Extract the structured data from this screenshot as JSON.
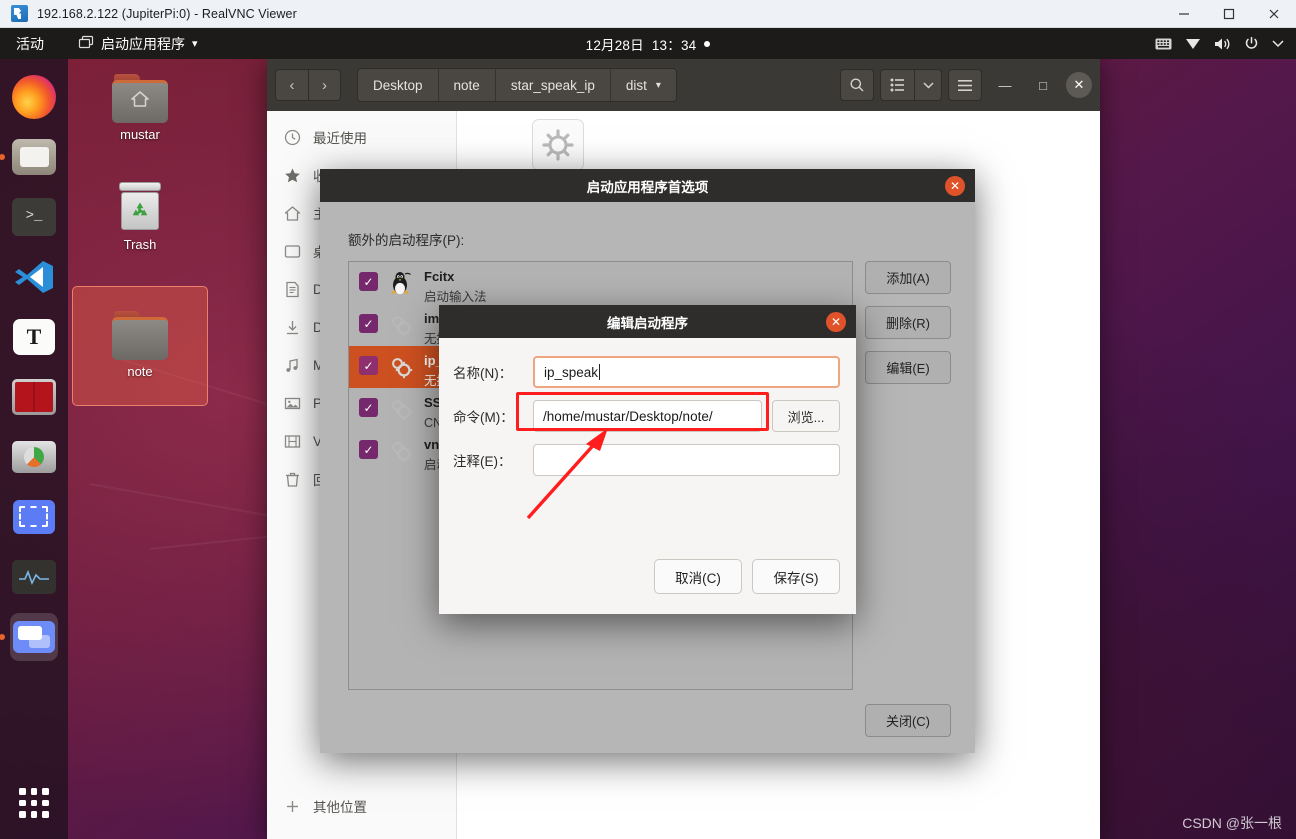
{
  "vnc_window": {
    "title": "192.168.2.122 (JupiterPi:0) - RealVNC Viewer",
    "icon": "realvnc-icon",
    "minimize_label": "—",
    "maximize_label": "☐",
    "close_label": "✕"
  },
  "gnome_panel": {
    "activities": "活动",
    "app_menu": "启动应用程序",
    "app_menu_arrow": "▾",
    "clock_date": "12月28日",
    "clock_time": "13：34",
    "tray": [
      "keyboard-icon",
      "network-icon",
      "volume-icon",
      "power-icon",
      "chevron-down-icon"
    ]
  },
  "dock": {
    "items": [
      {
        "name": "firefox",
        "running": false
      },
      {
        "name": "files",
        "running": true
      },
      {
        "name": "terminal",
        "running": false
      },
      {
        "name": "vscode",
        "running": false
      },
      {
        "name": "text-editor",
        "running": false
      },
      {
        "name": "red-app",
        "running": false
      },
      {
        "name": "disks",
        "running": false
      },
      {
        "name": "screenshot",
        "running": false
      },
      {
        "name": "system-monitor",
        "running": false
      },
      {
        "name": "remote-desktop",
        "running": true
      }
    ],
    "show_apps_label": "show-applications"
  },
  "desktop_icons": [
    {
      "label": "mustar",
      "type": "home-folder",
      "selected": false
    },
    {
      "label": "Trash",
      "type": "trash",
      "selected": false
    },
    {
      "label": "note",
      "type": "folder",
      "selected": true
    }
  ],
  "file_manager": {
    "back_label": "‹",
    "forward_label": "›",
    "breadcrumbs": [
      "Desktop",
      "note",
      "star_speak_ip",
      "dist"
    ],
    "breadcrumb_arrow": "▾",
    "search_icon": "search-icon",
    "view_list_icon": "list-view-icon",
    "view_dropdown_icon": "chevron-down-icon",
    "menu_icon": "hamburger-menu-icon",
    "minimize_label": "—",
    "maximize_label": "□",
    "close_label": "✕",
    "sidebar": [
      {
        "label": "最近使用",
        "icon": "clock-icon"
      },
      {
        "label": "收藏",
        "icon": "star-icon"
      },
      {
        "label": "主目录",
        "icon": "home-icon"
      },
      {
        "label": "桌面",
        "icon": "desktop-icon"
      },
      {
        "label": "Documents",
        "icon": "documents-icon"
      },
      {
        "label": "Downloads",
        "icon": "downloads-icon"
      },
      {
        "label": "Music",
        "icon": "music-icon"
      },
      {
        "label": "Pictures",
        "icon": "pictures-icon"
      },
      {
        "label": "Videos",
        "icon": "videos-icon"
      },
      {
        "label": "回收站",
        "icon": "trash-icon"
      },
      {
        "label": "其他位置",
        "icon": "plus-icon"
      }
    ]
  },
  "prefs_dialog": {
    "title": "启动应用程序首选项",
    "close_label": "✕",
    "section_label": "额外的启动程序(P):",
    "apps": [
      {
        "name": "Fcitx",
        "desc": "启动输入法",
        "checked": true,
        "selected": false,
        "icon": "tux-icon"
      },
      {
        "name": "im-la",
        "desc": "无描述",
        "checked": true,
        "selected": false,
        "icon": "gears-icon"
      },
      {
        "name": "ip_sp",
        "desc": "无描述",
        "checked": true,
        "selected": true,
        "icon": "gears-icon"
      },
      {
        "name": "SSH 密钥代理",
        "desc": "CNOME",
        "checked": true,
        "selected": false,
        "icon": "gears-icon"
      },
      {
        "name": "vncsb",
        "desc": "启动V",
        "checked": true,
        "selected": false,
        "icon": "gears-icon"
      }
    ],
    "buttons": {
      "add": "添加(A)",
      "remove": "删除(R)",
      "edit": "编辑(E)",
      "close": "关闭(C)"
    }
  },
  "edit_dialog": {
    "title": "编辑启动程序",
    "close_label": "✕",
    "fields": {
      "name_label": "名称(N)：",
      "name_value": "ip_speak",
      "command_label": "命令(M)：",
      "command_value": "/home/mustar/Desktop/note/",
      "browse_label": "浏览...",
      "comment_label": "注释(E)：",
      "comment_value": ""
    },
    "buttons": {
      "cancel": "取消(C)",
      "save": "保存(S)"
    }
  },
  "annotation": {
    "highlight_color": "#ff1d1d",
    "target": "command-field"
  },
  "watermark": {
    "text": "CSDN @张一根"
  }
}
